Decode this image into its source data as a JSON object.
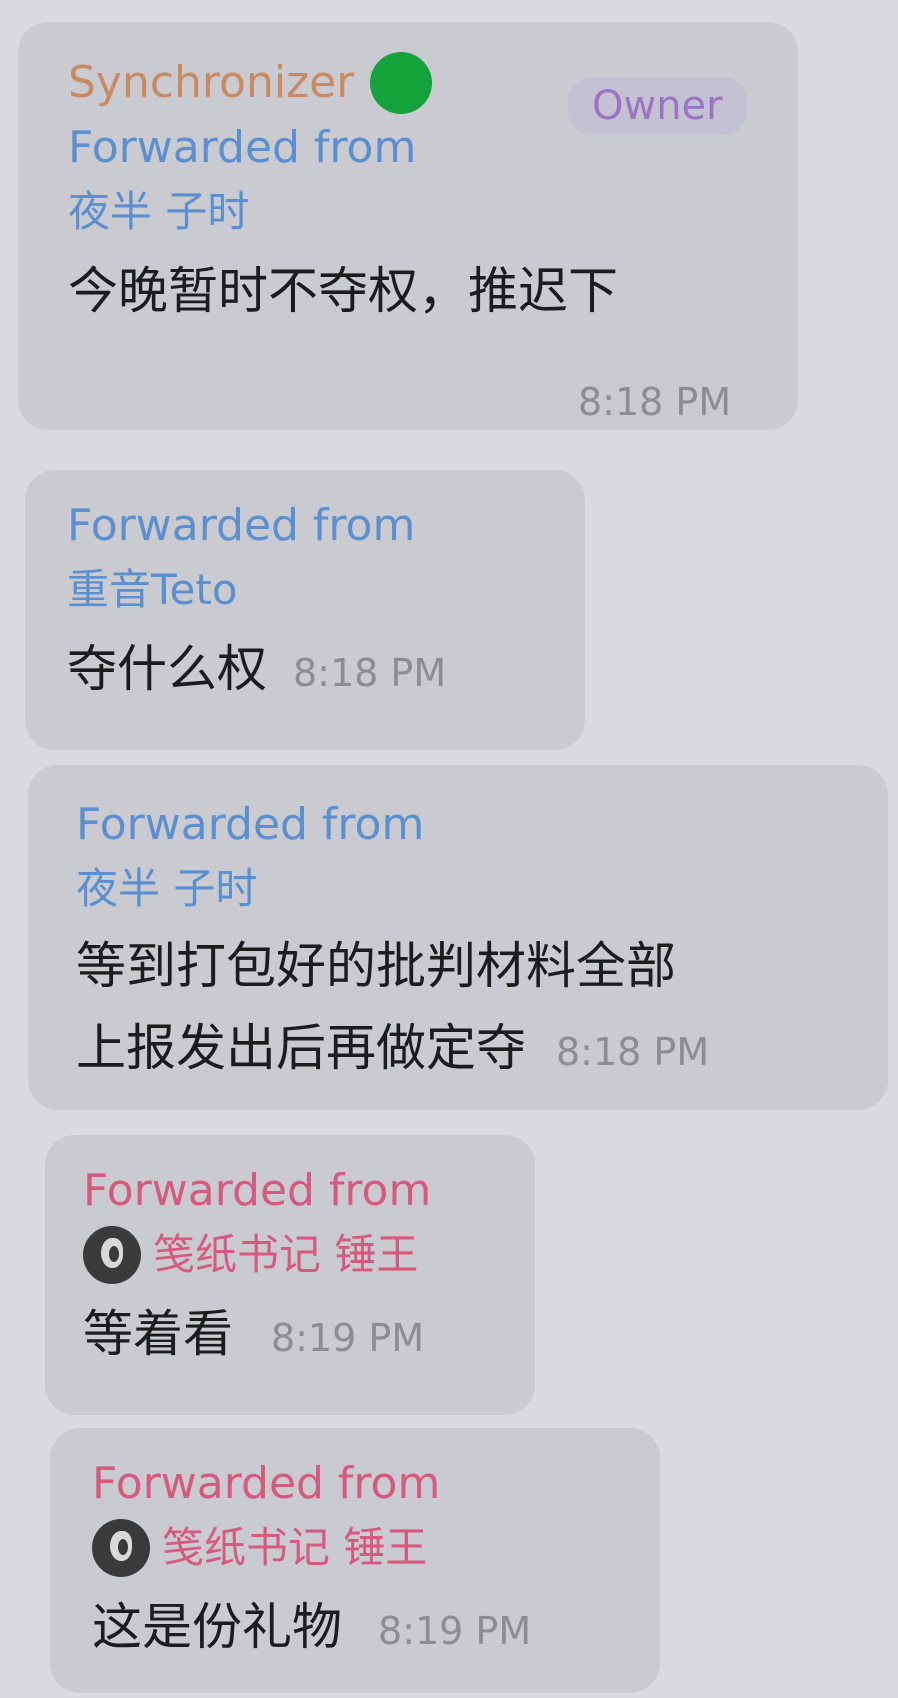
{
  "colors": {
    "background": "#d9dbe0",
    "bubble": "#c9cbd0",
    "sender_name": "#c98a62",
    "online_dot": "#14a23a",
    "owner_badge_text": "#9a74c2",
    "forward_blue": "#5b8fcf",
    "forward_pink": "#d55a7c",
    "timestamp": "#8b8d91"
  },
  "messages": [
    {
      "sender": "Synchronizer",
      "role_badge": "Owner",
      "forwarded_label": "Forwarded from",
      "forwarded_name": "夜半 子时",
      "text": "今晚暂时不夺权，推迟下",
      "time": "8:18 PM"
    },
    {
      "forwarded_label": "Forwarded from",
      "forwarded_name": "重音Teto",
      "text": "夺什么权",
      "time": "8:18 PM"
    },
    {
      "forwarded_label": "Forwarded from",
      "forwarded_name": "夜半 子时",
      "text_line1": "等到打包好的批判材料全部",
      "text_line2": "上报发出后再做定夺",
      "time": "8:18 PM"
    },
    {
      "forwarded_label": "Forwarded from",
      "forwarded_name": "笺纸书记 锤王",
      "avatar": "user-avatar-icon",
      "text": "等着看",
      "time": "8:19 PM"
    },
    {
      "forwarded_label": "Forwarded from",
      "forwarded_name": "笺纸书记 锤王",
      "avatar": "user-avatar-icon",
      "text": "这是份礼物",
      "time": "8:19 PM"
    }
  ]
}
